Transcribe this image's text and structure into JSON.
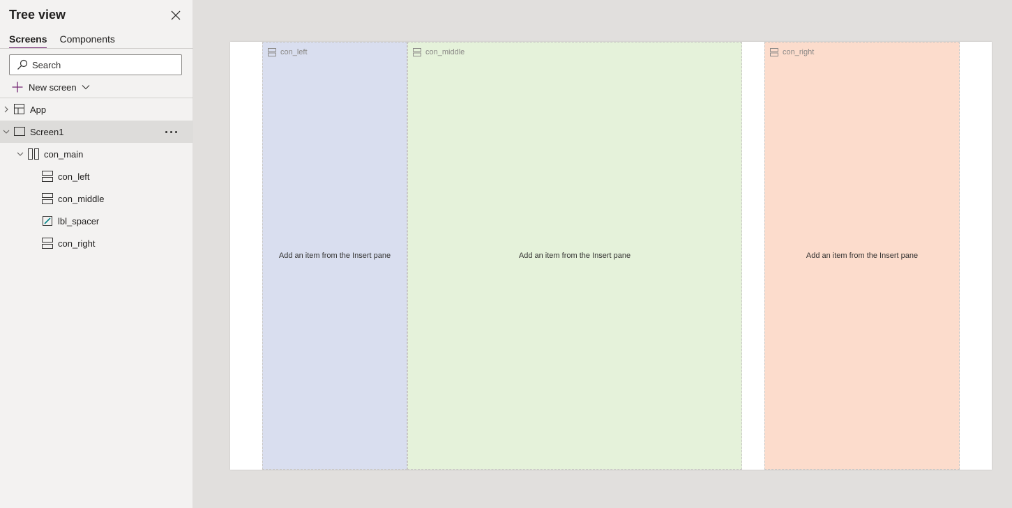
{
  "panel": {
    "title": "Tree view",
    "tabs": [
      {
        "label": "Screens",
        "active": true
      },
      {
        "label": "Components",
        "active": false
      }
    ],
    "search_placeholder": "Search",
    "new_screen_label": "New screen"
  },
  "tree": {
    "app": {
      "label": "App",
      "icon": "app-grid-icon"
    },
    "screen1": {
      "label": "Screen1",
      "icon": "screen-icon",
      "selected": true
    },
    "con_main": {
      "label": "con_main",
      "icon": "horizontal-container-icon"
    },
    "children": [
      {
        "label": "con_left",
        "icon": "vertical-container-icon"
      },
      {
        "label": "con_middle",
        "icon": "vertical-container-icon"
      },
      {
        "label": "lbl_spacer",
        "icon": "label-edit-icon"
      },
      {
        "label": "con_right",
        "icon": "vertical-container-icon"
      }
    ]
  },
  "canvas": {
    "containers": [
      {
        "name": "con_left",
        "hint": "Add an item from the Insert pane",
        "color": "#d9deef"
      },
      {
        "name": "con_middle",
        "hint": "Add an item from the Insert pane",
        "color": "#e5f2da"
      },
      {
        "name": "con_right",
        "hint": "Add an item from the Insert pane",
        "color": "#fcdccc"
      }
    ]
  },
  "colors": {
    "accent": "#742774",
    "panel_bg": "#f3f2f1",
    "workspace_bg": "#e1dfdd",
    "selected_row": "#dddcda"
  }
}
